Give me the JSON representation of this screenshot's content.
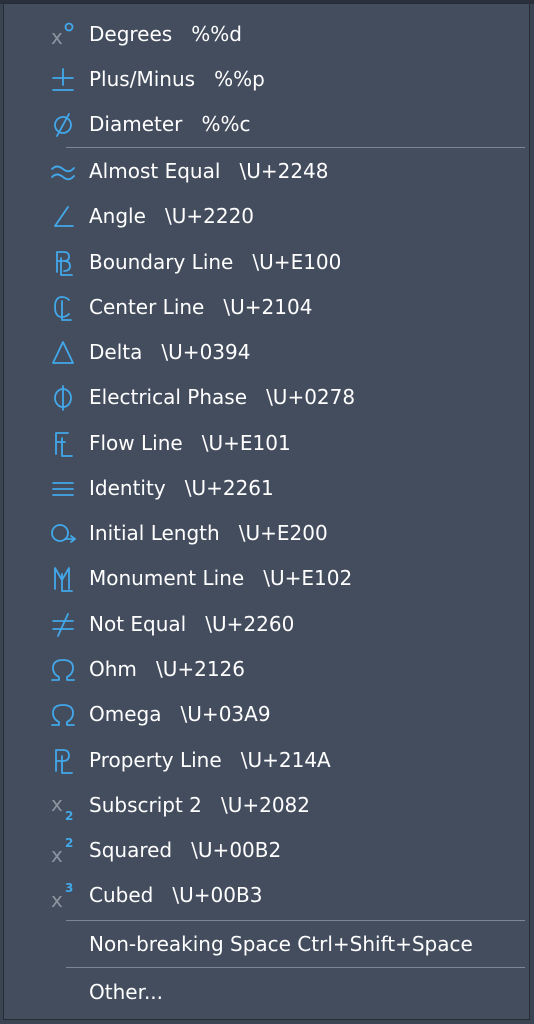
{
  "menu": {
    "items": [
      {
        "label": "Degrees   %%d",
        "icon": "degrees-icon"
      },
      {
        "label": "Plus/Minus   %%p",
        "icon": "plus-minus-icon"
      },
      {
        "label": "Diameter   %%c",
        "icon": "diameter-icon"
      },
      {
        "label": "Almost Equal   \\U+2248",
        "icon": "almost-equal-icon"
      },
      {
        "label": "Angle   \\U+2220",
        "icon": "angle-icon"
      },
      {
        "label": "Boundary Line   \\U+E100",
        "icon": "boundary-line-icon"
      },
      {
        "label": "Center Line   \\U+2104",
        "icon": "center-line-icon"
      },
      {
        "label": "Delta   \\U+0394",
        "icon": "delta-icon"
      },
      {
        "label": "Electrical Phase   \\U+0278",
        "icon": "electrical-phase-icon"
      },
      {
        "label": "Flow Line   \\U+E101",
        "icon": "flow-line-icon"
      },
      {
        "label": "Identity   \\U+2261",
        "icon": "identity-icon"
      },
      {
        "label": "Initial Length   \\U+E200",
        "icon": "initial-length-icon"
      },
      {
        "label": "Monument Line   \\U+E102",
        "icon": "monument-line-icon"
      },
      {
        "label": "Not Equal   \\U+2260",
        "icon": "not-equal-icon"
      },
      {
        "label": "Ohm   \\U+2126",
        "icon": "ohm-icon"
      },
      {
        "label": "Omega   \\U+03A9",
        "icon": "omega-icon"
      },
      {
        "label": "Property Line   \\U+214A",
        "icon": "property-line-icon"
      },
      {
        "label": "Subscript 2   \\U+2082",
        "icon": "subscript-2-icon"
      },
      {
        "label": "Squared   \\U+00B2",
        "icon": "squared-icon"
      },
      {
        "label": "Cubed   \\U+00B3",
        "icon": "cubed-icon"
      },
      {
        "label": "Non-breaking Space Ctrl+Shift+Space",
        "icon": ""
      },
      {
        "label": "Other...",
        "icon": ""
      }
    ]
  },
  "colors": {
    "menu_background": "#444d5e",
    "icon_accent": "#42a8ea",
    "text": "#ffffff",
    "separator": "#7d8593"
  }
}
